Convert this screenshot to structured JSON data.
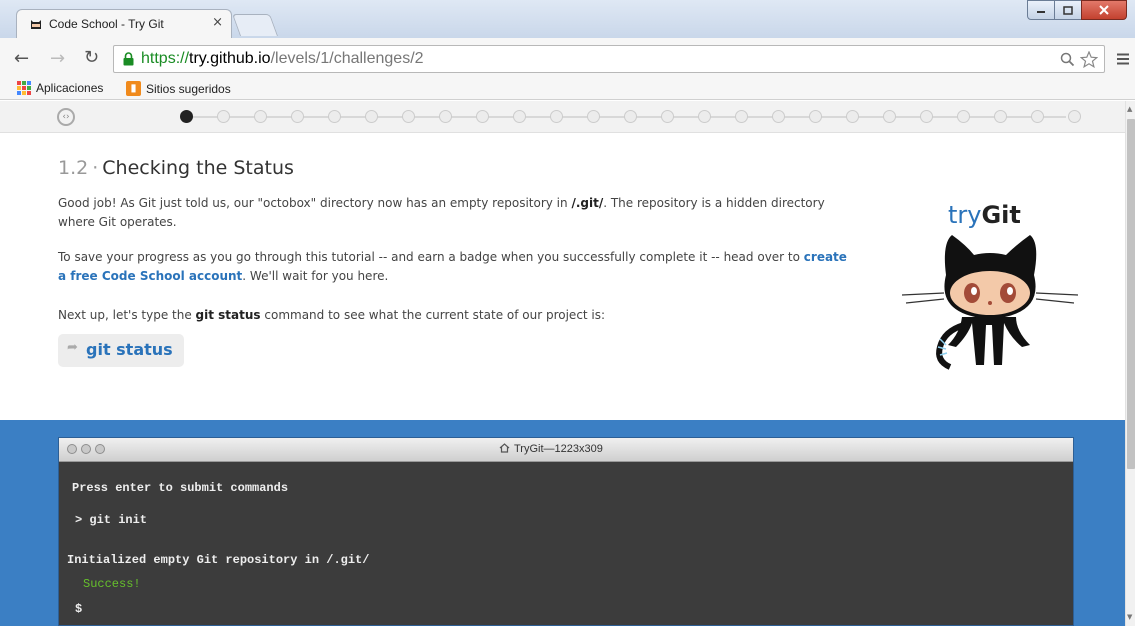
{
  "browser": {
    "tab_title": "Code School - Try Git",
    "tab_close": "×",
    "url_scheme": "https://",
    "url_host": "try.github.io",
    "url_path": "/levels/1/challenges/2",
    "bookmarks": [
      {
        "label": "Aplicaciones",
        "icon": "apps-grid-icon"
      },
      {
        "label": "Sitios sugeridos",
        "icon": "suggested-sites-icon"
      }
    ],
    "colors": {
      "secure": "#1a8c24",
      "titlebar": "#c9d7ea"
    }
  },
  "progress": {
    "total": 25,
    "current": 1
  },
  "lesson": {
    "number": "1.2",
    "separator": "·",
    "title": "Checking the Status",
    "p1_a": "Good job! As Git just told us, our \"octobox\" directory now has an empty repository in ",
    "p1_b": "/.git/",
    "p1_c": ". The repository is a hidden directory where Git operates.",
    "p2_a": "To save your progress as you go through this tutorial -- and earn a badge when you successfully complete it -- head over to ",
    "p2_link": "create a free Code School account",
    "p2_c": ". We'll wait for you here.",
    "p3_a": "Next up, let's type the ",
    "p3_b": "git status",
    "p3_c": " command to see what the current state of our project is:",
    "command_button": "git status",
    "colors": {
      "link": "#2a73ba",
      "band": "#3b7fc4"
    }
  },
  "logo": {
    "prefix": "try",
    "suffix": "Git"
  },
  "terminal": {
    "title": "TryGit—1223x309",
    "lines": [
      {
        "text": "Press enter to submit commands",
        "kind": "info"
      },
      {
        "text": "> git init",
        "kind": "input"
      },
      {
        "text": "Initialized empty Git repository in /.git/",
        "kind": "output"
      },
      {
        "text": "Success!",
        "kind": "success"
      },
      {
        "text": "$",
        "kind": "prompt"
      }
    ],
    "colors": {
      "background": "#3c3c3c",
      "success": "#66c02c"
    }
  }
}
